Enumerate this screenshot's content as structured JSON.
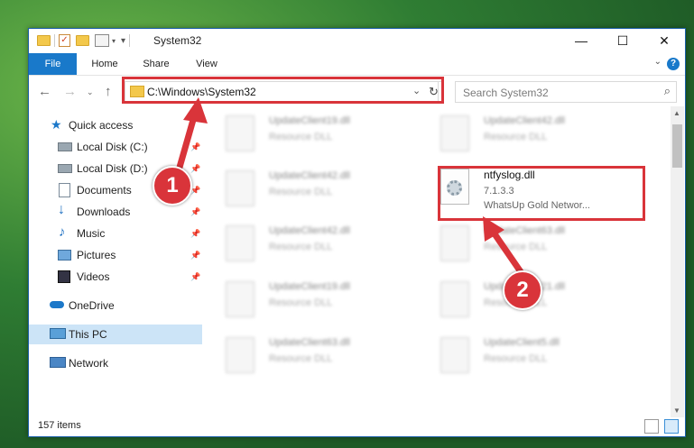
{
  "window": {
    "title": "System32",
    "controls": {
      "minimize": "—",
      "maximize": "☐",
      "close": "✕"
    }
  },
  "ribbon": {
    "tabs": [
      "File",
      "Home",
      "Share",
      "View"
    ],
    "help": "?"
  },
  "address": {
    "path": "C:\\Windows\\System32",
    "search_placeholder": "Search System32"
  },
  "sidebar": {
    "items": [
      {
        "label": "Quick access",
        "icon": "star-icon",
        "pinned": false
      },
      {
        "label": "Local Disk (C:)",
        "icon": "drive-icon",
        "pinned": true
      },
      {
        "label": "Local Disk (D:)",
        "icon": "drive-icon",
        "pinned": true
      },
      {
        "label": "Documents",
        "icon": "documents-icon",
        "pinned": true
      },
      {
        "label": "Downloads",
        "icon": "download-icon",
        "pinned": true
      },
      {
        "label": "Music",
        "icon": "music-icon",
        "pinned": true
      },
      {
        "label": "Pictures",
        "icon": "pictures-icon",
        "pinned": true
      },
      {
        "label": "Videos",
        "icon": "videos-icon",
        "pinned": true
      },
      {
        "label": "OneDrive",
        "icon": "cloud-icon",
        "pinned": false
      },
      {
        "label": "This PC",
        "icon": "computer-icon",
        "pinned": false,
        "selected": true
      },
      {
        "label": "Network",
        "icon": "network-icon",
        "pinned": false
      }
    ]
  },
  "files": [
    {
      "name": "UpdateClient19.dll",
      "type": "Resource DLL"
    },
    {
      "name": "UpdateClient42.dll",
      "type": "Resource DLL"
    },
    {
      "name": "UpdateClient42.dll",
      "type": "Resource DLL"
    },
    {
      "name": "ntfyslog.dll",
      "version": "7.1.3.3",
      "description": "WhatsUp Gold Networ...",
      "highlighted": true
    },
    {
      "name": "UpdateClient42.dll",
      "type": "Resource DLL"
    },
    {
      "name": "UpdateClient63.dll",
      "type": "Resource DLL"
    },
    {
      "name": "UpdateClient19.dll",
      "type": "Resource DLL"
    },
    {
      "name": "UpdateClient21.dll",
      "type": "Resource DLL"
    },
    {
      "name": "UpdateClient63.dll",
      "type": "Resource DLL"
    },
    {
      "name": "UpdateClient5.dll",
      "type": "Resource DLL"
    }
  ],
  "status": {
    "item_count": "157 items"
  },
  "annotations": {
    "step1": "1",
    "step2": "2",
    "color": "#d9343a"
  }
}
